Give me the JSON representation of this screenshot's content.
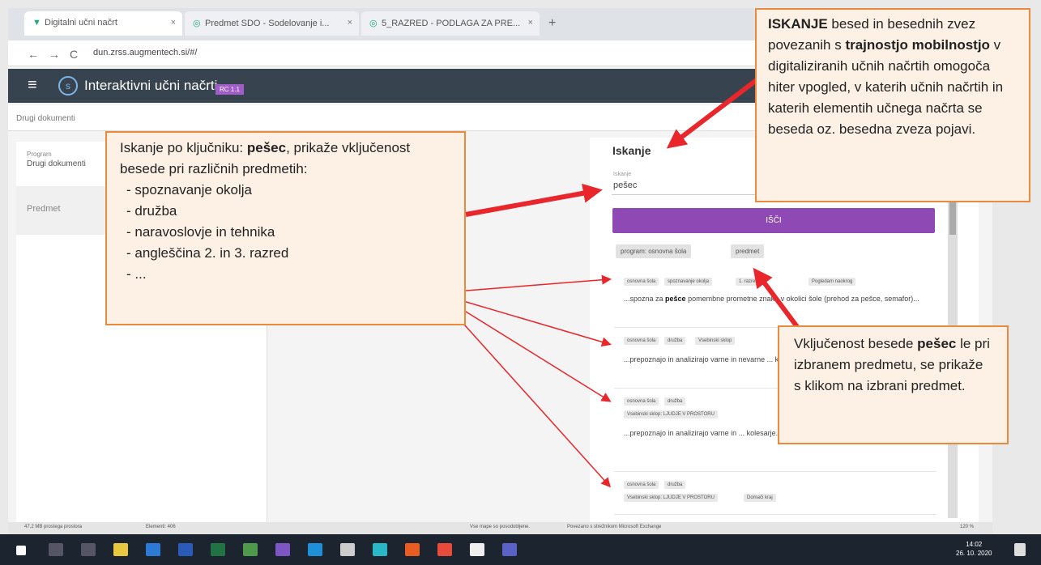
{
  "browser": {
    "tabs": [
      {
        "label": "Digitalni učni načrt",
        "close": "×"
      },
      {
        "label": "Predmet SDO - Sodelovanje i...",
        "close": "×"
      },
      {
        "label": "5_RAZRED - PODLAGA ZA PRE...",
        "close": "×"
      }
    ],
    "new_tab": "+",
    "nav": {
      "back": "←",
      "forward": "→",
      "reload": "C"
    },
    "url": "dun.zrss.augmentech.si/#/"
  },
  "app": {
    "menu_icon": "≡",
    "logo_letter": "s",
    "title": "Interaktivni učni načrti",
    "version": "RC 1.1",
    "subheader": "Drugi dokumenti",
    "left": {
      "program_label": "Program",
      "program_value": "Drugi dokumenti",
      "predmet": "Predmet"
    },
    "search": {
      "title": "Iskanje",
      "field_label": "Iskanje",
      "field_value": "pešec",
      "button": "IŠČI",
      "chips": [
        "program: osnovna šola",
        "predmet"
      ],
      "results": [
        {
          "tags": [
            "osnovna šola",
            "spoznavanje okolja",
            "1. razred",
            "Pogledam naokrog"
          ],
          "text_before": "...spozna za ",
          "bold": "pešce",
          "text_after": " pomembne prometne znake v okolici šole (prehod za pešce, semafor)..."
        },
        {
          "tags": [
            "osnovna šola",
            "družba",
            "Vsebinski sklop"
          ],
          "text_before": "...prepoznajo in analizirajo varne in nevarne",
          "bold": "",
          "text_after": " ... kolesarje..."
        },
        {
          "tags": [
            "osnovna šola",
            "družba",
            "Vsebinski sklop: LJUDJE V PROSTORU"
          ],
          "text_before": "...prepoznajo in analizirajo varne in",
          "bold": "",
          "text_after": " ... kolesarje..."
        },
        {
          "tags": [
            "osnovna šola",
            "družba",
            "Vsebinski sklop: LJUDJE V PROSTORU",
            "Domači kraj"
          ],
          "text_before": "",
          "bold": "",
          "text_after": ""
        }
      ]
    }
  },
  "status": {
    "left": "47,2 MB prostega prostora",
    "elements": "Elementi: 406",
    "mid": "Vse mape so posodobljene.",
    "right": "Povezano s strežnikom Microsoft Exchange",
    "zoom": "120 %"
  },
  "taskbar": {
    "time": "14:02",
    "date": "26. 10. 2020"
  },
  "notes": {
    "left_intro": "Iskanje po ključniku: ",
    "left_keyword": "pešec",
    "left_rest": ", prikaže vključenost besede pri različnih predmetih:",
    "left_items": [
      "- spoznavanje okolja",
      "- družba",
      "- naravoslovje in tehnika",
      "- angleščina 2. in 3. razred",
      "- ..."
    ],
    "top_bold1": "ISKANJE",
    "top_text1": " besed in besednih zvez povezanih s ",
    "top_bold2": "trajnostjo mobilnostjo",
    "top_text2": " v digitaliziranih učnih načrtih omogoča hiter vpogled, v katerih učnih načrtih in katerih elementih učnega načrta se beseda oz. besedna zveza pojavi.",
    "bottom_text1": "Vključenost besede ",
    "bottom_bold": "pešec",
    "bottom_text2": " le pri izbranem predmetu, se prikaže s klikom na izbrani predmet."
  },
  "colors": {
    "accent": "#8f49b4",
    "header": "#37434f",
    "note_border": "#e98a3f",
    "arrow": "#e8262b"
  }
}
